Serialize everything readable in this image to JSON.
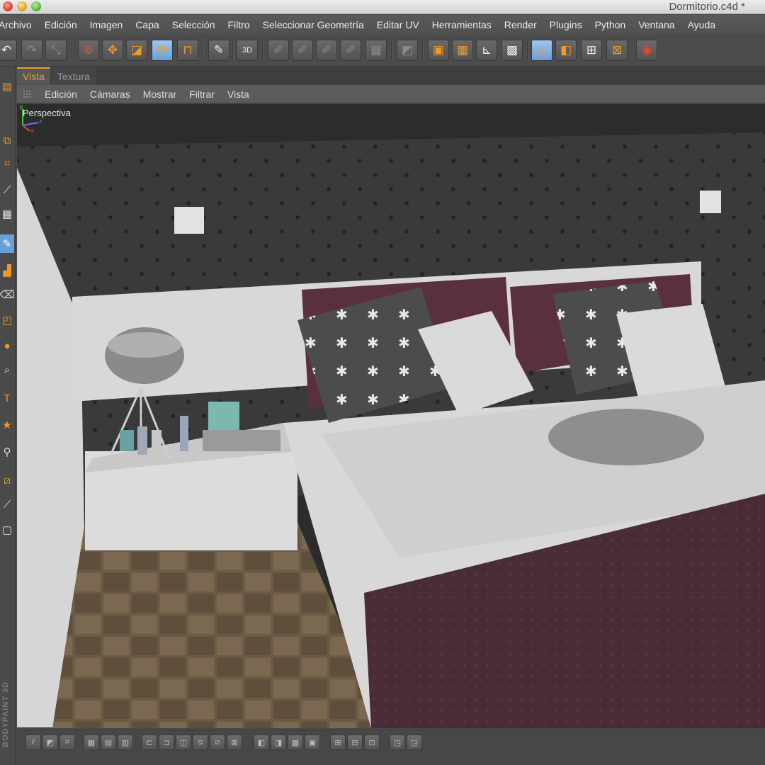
{
  "window": {
    "title": "Dormitorio.c4d *"
  },
  "menu": [
    "Archivo",
    "Edición",
    "Imagen",
    "Capa",
    "Selección",
    "Filtro",
    "Seleccionar Geometría",
    "Editar UV",
    "Herramientas",
    "Render",
    "Plugins",
    "Python",
    "Ventana",
    "Ayuda"
  ],
  "tabs": [
    {
      "label": "Vista",
      "active": true
    },
    {
      "label": "Textura",
      "active": false
    }
  ],
  "viewport_menu": [
    "Edición",
    "Cámaras",
    "Mostrar",
    "Filtrar",
    "Vista"
  ],
  "viewport": {
    "label": "Perspectiva",
    "axis": {
      "y": "y",
      "z": "z",
      "x": "x"
    }
  },
  "brand_label": "BODYPAINT 3D",
  "colors": {
    "accent": "#f09a24",
    "active_blue": "#6a9ed8",
    "wall": "#3a3a3a",
    "headboard": "#d8d8d8",
    "bedspread": "#4a2b38",
    "floor": "#6b5a44"
  },
  "toolbar_icons": [
    "undo-icon",
    "redo-icon",
    "transform-icon",
    "live-selection-icon",
    "move-icon",
    "scale-icon",
    "rotate-icon",
    "magnet-icon",
    "paint-setup-icon",
    "3d-paint-icon",
    "brush-icon",
    "uv-edit-icon",
    "render-icon"
  ],
  "left_icons": [
    "layers-icon",
    "object-icon",
    "crop-icon",
    "pen-icon",
    "grid-icon",
    "brush-icon",
    "stamp-icon",
    "eraser-icon",
    "fill-icon",
    "blur-icon",
    "zoom-icon",
    "text-icon",
    "star-icon",
    "eyedropper-icon",
    "warp-icon",
    "smudge-icon",
    "clone-icon"
  ]
}
